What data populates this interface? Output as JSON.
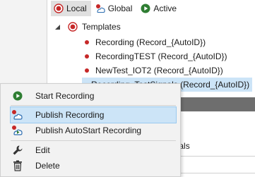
{
  "tabs": [
    {
      "label": "Local",
      "icon": "record-icon",
      "selected": true
    },
    {
      "label": "Global",
      "icon": "global-record-icon",
      "selected": false
    },
    {
      "label": "Active",
      "icon": "play-icon",
      "selected": false
    }
  ],
  "tree": {
    "root_label": "Templates",
    "items": [
      {
        "label": "Recording (Record_{AutoID})",
        "selected": false
      },
      {
        "label": "RecordingTEST (Record_{AutoID})",
        "selected": false
      },
      {
        "label": "NewTest_IOT2 (Record_{AutoID})",
        "selected": false
      },
      {
        "label": "Recording_TestSignals (Record_{AutoID})",
        "selected": true
      }
    ]
  },
  "background": {
    "partial_text": "gnals"
  },
  "context_menu": {
    "items": [
      {
        "label": "Start Recording",
        "icon": "play-icon"
      },
      {
        "label": "Publish Recording",
        "icon": "publish-icon",
        "highlighted": true
      },
      {
        "label": "Publish AutoStart Recording",
        "icon": "publish-autostart-icon"
      },
      {
        "label": "Edit",
        "icon": "wrench-icon"
      },
      {
        "label": "Delete",
        "icon": "trash-icon"
      }
    ]
  },
  "colors": {
    "record_red": "#c62828",
    "play_green": "#2e7d32",
    "selection_blue": "#cce4f7",
    "cloud_blue": "#2b6cb0"
  }
}
